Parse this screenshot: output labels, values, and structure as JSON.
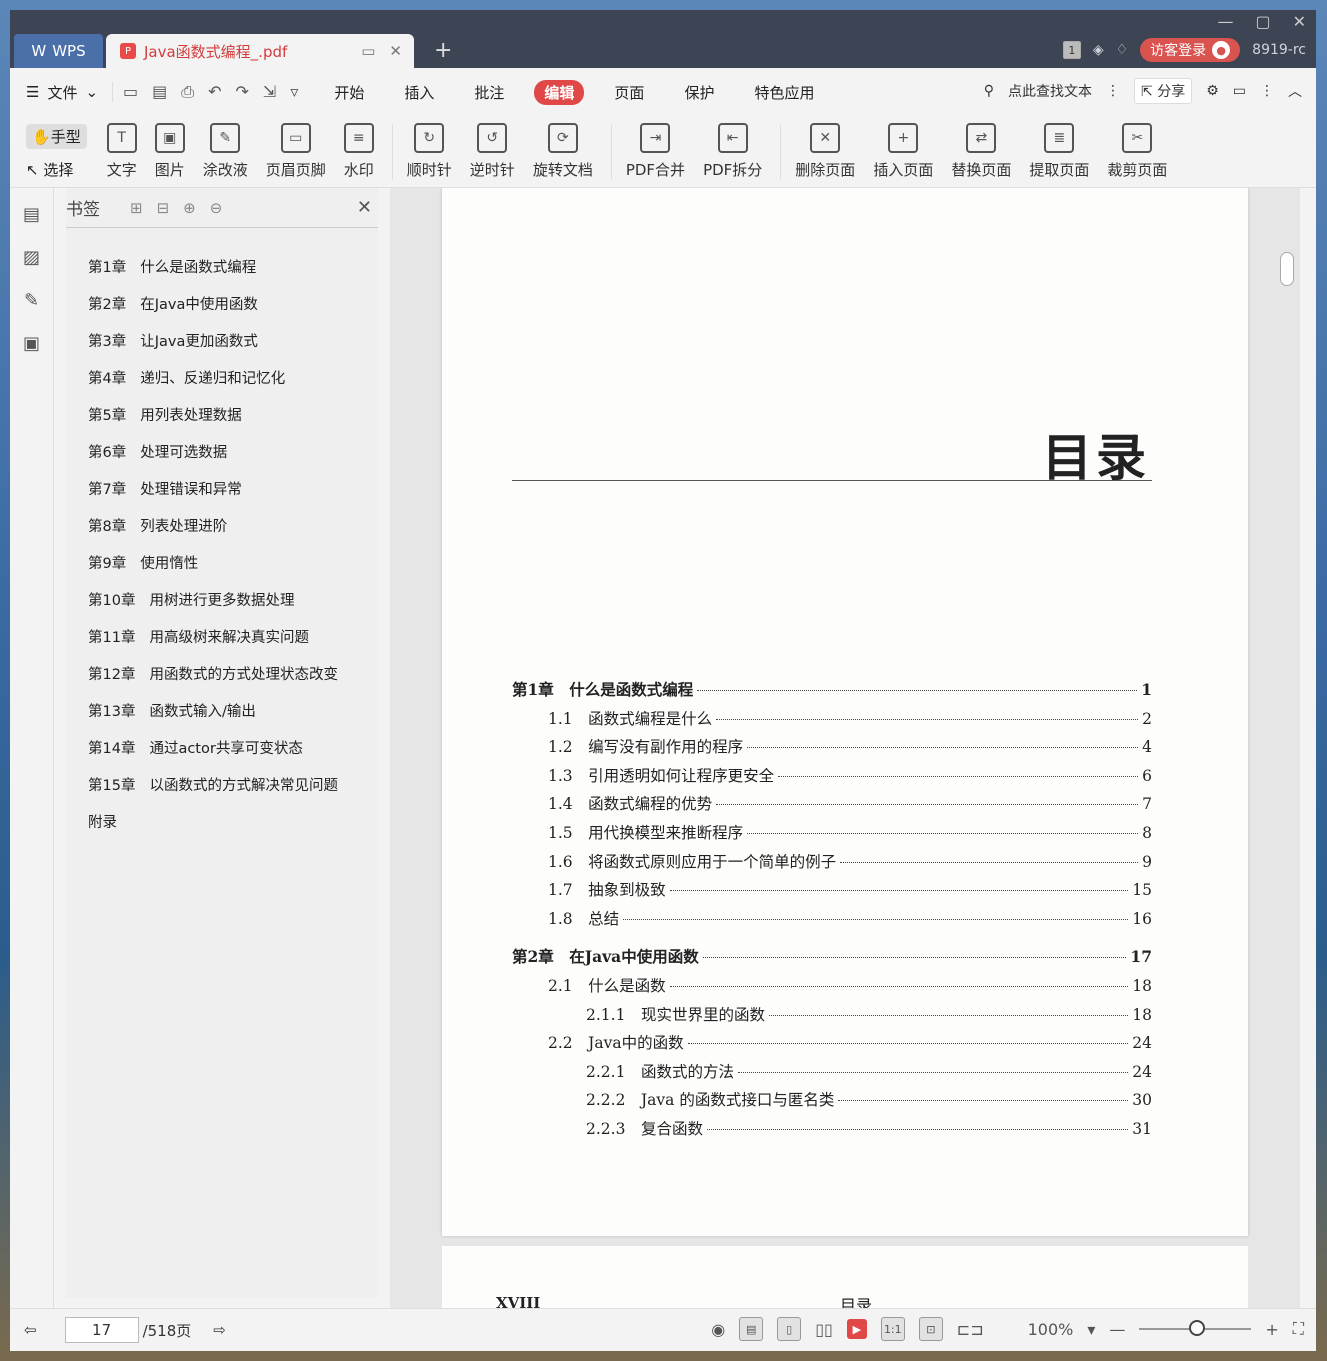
{
  "titlebar": {
    "app_tab": "WPS",
    "doc_tab": "Java函数式编程_.pdf",
    "page_badge": "1",
    "login_button": "访客登录",
    "version": "8919-rc"
  },
  "menubar": {
    "file_label": "文件",
    "items": [
      "开始",
      "插入",
      "批注",
      "编辑",
      "页面",
      "保护",
      "特色应用"
    ],
    "active": "编辑",
    "search_label": "点此查找文本",
    "share_label": "分享"
  },
  "ribbon": {
    "hand_label": "手型",
    "select_label": "选择",
    "tools": [
      "文字",
      "图片",
      "涂改液",
      "页眉页脚",
      "水印",
      "顺时针",
      "逆时针",
      "旋转文档",
      "PDF合并",
      "PDF拆分",
      "删除页面",
      "插入页面",
      "替换页面",
      "提取页面",
      "裁剪页面"
    ]
  },
  "bookmarks": {
    "title": "书签",
    "items": [
      {
        "num": "第1章",
        "text": "什么是函数式编程"
      },
      {
        "num": "第2章",
        "text": "在Java中使用函数"
      },
      {
        "num": "第3章",
        "text": "让Java更加函数式"
      },
      {
        "num": "第4章",
        "text": "递归、反递归和记忆化"
      },
      {
        "num": "第5章",
        "text": "用列表处理数据"
      },
      {
        "num": "第6章",
        "text": "处理可选数据"
      },
      {
        "num": "第7章",
        "text": "处理错误和异常"
      },
      {
        "num": "第8章",
        "text": "列表处理进阶"
      },
      {
        "num": "第9章",
        "text": "使用惰性"
      },
      {
        "num": "第10章",
        "text": "用树进行更多数据处理"
      },
      {
        "num": "第11章",
        "text": "用高级树来解决真实问题"
      },
      {
        "num": "第12章",
        "text": "用函数式的方式处理状态改变"
      },
      {
        "num": "第13章",
        "text": "函数式输入/输出"
      },
      {
        "num": "第14章",
        "text": "通过actor共享可变状态"
      },
      {
        "num": "第15章",
        "text": "以函数式的方式解决常见问题"
      },
      {
        "num": "",
        "text": "附录"
      }
    ]
  },
  "document": {
    "toc_title": "目录",
    "entries": [
      {
        "label": "第1章　什么是函数式编程",
        "page": "1",
        "level": 0
      },
      {
        "label": "1.1　函数式编程是什么",
        "page": "2",
        "level": 1
      },
      {
        "label": "1.2　编写没有副作用的程序",
        "page": "4",
        "level": 1
      },
      {
        "label": "1.3　引用透明如何让程序更安全",
        "page": "6",
        "level": 1
      },
      {
        "label": "1.4　函数式编程的优势",
        "page": "7",
        "level": 1
      },
      {
        "label": "1.5　用代换模型来推断程序",
        "page": "8",
        "level": 1
      },
      {
        "label": "1.6　将函数式原则应用于一个简单的例子",
        "page": "9",
        "level": 1
      },
      {
        "label": "1.7　抽象到极致",
        "page": "15",
        "level": 1
      },
      {
        "label": "1.8　总结",
        "page": "16",
        "level": 1
      },
      {
        "label": "第2章　在Java中使用函数",
        "page": "17",
        "level": 0
      },
      {
        "label": "2.1　什么是函数",
        "page": "18",
        "level": 1
      },
      {
        "label": "2.1.1　现实世界里的函数",
        "page": "18",
        "level": 2
      },
      {
        "label": "2.2　Java中的函数",
        "page": "24",
        "level": 1
      },
      {
        "label": "2.2.1　函数式的方法",
        "page": "24",
        "level": 2
      },
      {
        "label": "2.2.2　Java 的函数式接口与匿名类",
        "page": "30",
        "level": 2
      },
      {
        "label": "2.2.3　复合函数",
        "page": "31",
        "level": 2
      }
    ],
    "next_page_left": "XVIII",
    "next_page_center": "目录"
  },
  "statusbar": {
    "current_page": "17",
    "total_pages": "/518页",
    "zoom": "100%"
  }
}
